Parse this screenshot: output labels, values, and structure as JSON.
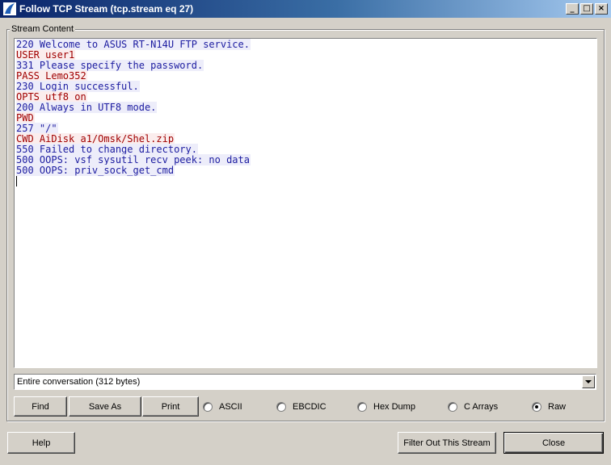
{
  "window": {
    "title": "Follow TCP Stream (tcp.stream eq 27)",
    "controls": {
      "minimize": "_",
      "maximize": "□",
      "close": "×"
    }
  },
  "stream": {
    "group_label": "Stream Content",
    "colors": {
      "server_text": "#1c1ca0",
      "server_bg": "#ededfa",
      "client_text": "#a00000",
      "client_bg": "#fbeded"
    },
    "lines": [
      {
        "text": "220 Welcome to ASUS RT-N14U FTP service.",
        "dir": "server"
      },
      {
        "text": "USER user1",
        "dir": "client"
      },
      {
        "text": "331 Please specify the password.",
        "dir": "server"
      },
      {
        "text": "PASS Lemo352",
        "dir": "client"
      },
      {
        "text": "230 Login successful.",
        "dir": "server"
      },
      {
        "text": "OPTS utf8 on",
        "dir": "client"
      },
      {
        "text": "200 Always in UTF8 mode.",
        "dir": "server"
      },
      {
        "text": "PWD",
        "dir": "client"
      },
      {
        "text": "257 \"/\"",
        "dir": "server"
      },
      {
        "text": "CWD AiDisk_a1/Omsk/Shel.zip",
        "dir": "client"
      },
      {
        "text": "550 Failed to change directory.",
        "dir": "server"
      },
      {
        "text": "500 OOPS: vsf_sysutil_recv_peek: no data",
        "dir": "server"
      },
      {
        "text": "500 OOPS: priv_sock_get_cmd",
        "dir": "server"
      }
    ]
  },
  "conversation_select": {
    "value": "Entire conversation (312 bytes)"
  },
  "actions": {
    "find": "Find",
    "save_as": "Save As",
    "print": "Print"
  },
  "format": {
    "options": [
      "ASCII",
      "EBCDIC",
      "Hex Dump",
      "C Arrays",
      "Raw"
    ],
    "selected": "Raw"
  },
  "footer": {
    "help": "Help",
    "filter_out": "Filter Out This Stream",
    "close": "Close"
  }
}
